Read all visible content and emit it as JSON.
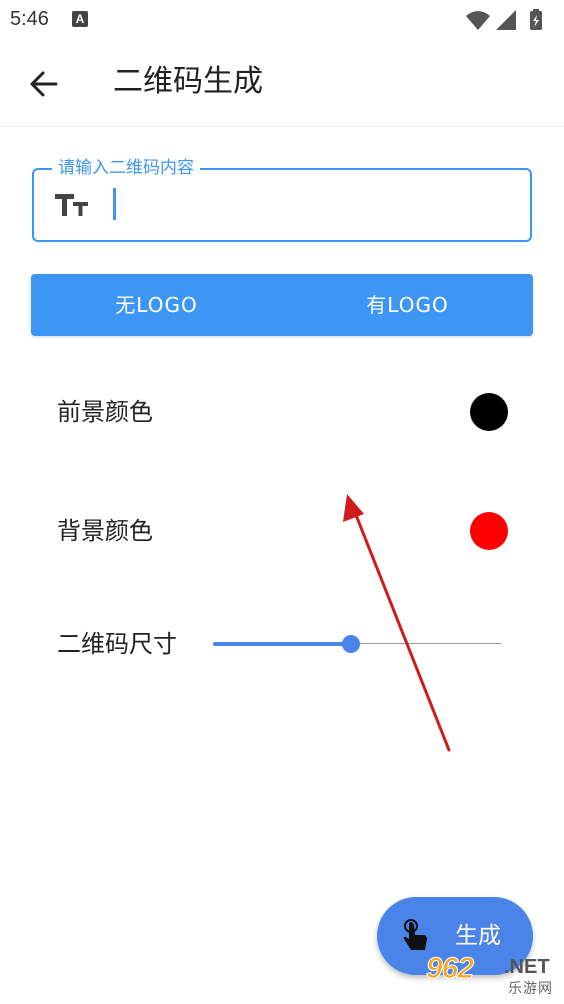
{
  "status_bar": {
    "time": "5:46",
    "notification_glyph": "A",
    "icons": [
      "wifi-icon",
      "signal-icon",
      "battery-icon"
    ]
  },
  "app_bar": {
    "title": "二维码生成",
    "back_icon": "arrow-left-icon"
  },
  "input": {
    "label": "请输入二维码内容",
    "value": "",
    "icon": "text-size-icon"
  },
  "logo_toggle": {
    "options": [
      "无LOGO",
      "有LOGO"
    ]
  },
  "foreground": {
    "label": "前景颜色",
    "color": "#000000"
  },
  "background": {
    "label": "背景颜色",
    "color": "#ff0000"
  },
  "qr_size": {
    "label": "二维码尺寸",
    "value_fraction": 0.48
  },
  "generate_button": {
    "label": "生成",
    "icon": "touch-hand-icon"
  },
  "watermark": {
    "brand": "962",
    "domain": ".NET",
    "site_name": "乐游网"
  },
  "colors": {
    "accent": "#3d96f4",
    "fab": "#4a84e8",
    "annotation": "#d11a1a"
  }
}
